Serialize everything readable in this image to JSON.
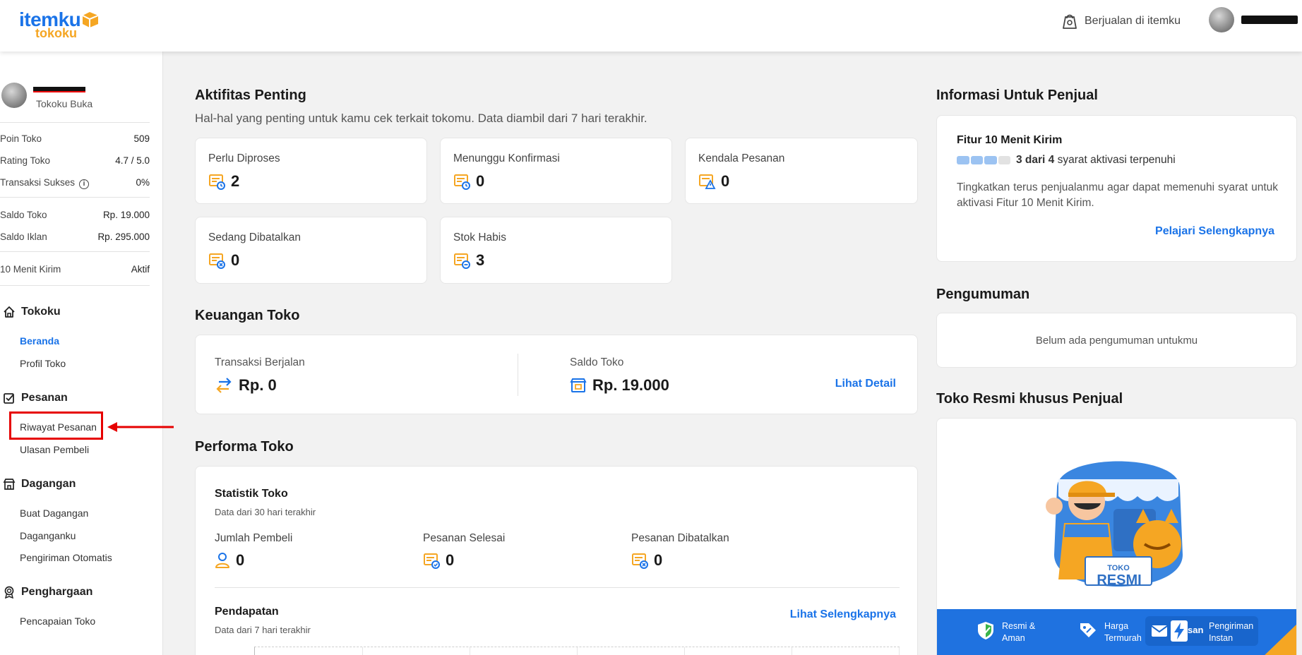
{
  "header": {
    "logo_main": "itemku",
    "logo_sub": "tokoku",
    "sell_label": "Berjualan di itemku"
  },
  "sidebar": {
    "shop_status": "Tokoku Buka",
    "stats": [
      {
        "label": "Poin Toko",
        "value": "509"
      },
      {
        "label": "Rating Toko",
        "value": "4.7 / 5.0"
      },
      {
        "label": "Transaksi Sukses",
        "value": "0%"
      },
      {
        "label": "Saldo Toko",
        "value": "Rp. 19.000"
      },
      {
        "label": "Saldo Iklan",
        "value": "Rp. 295.000"
      },
      {
        "label": "10 Menit Kirim",
        "value": "Aktif"
      }
    ],
    "sections": [
      {
        "title": "Tokoku",
        "items": [
          "Beranda",
          "Profil Toko"
        ]
      },
      {
        "title": "Pesanan",
        "items": [
          "Riwayat Pesanan",
          "Ulasan Pembeli"
        ]
      },
      {
        "title": "Dagangan",
        "items": [
          "Buat Dagangan",
          "Daganganku",
          "Pengiriman Otomatis"
        ]
      },
      {
        "title": "Penghargaan",
        "items": [
          "Pencapaian Toko"
        ]
      }
    ]
  },
  "aktifitas": {
    "title": "Aktifitas Penting",
    "subtitle": "Hal-hal yang penting untuk kamu cek terkait tokomu. Data diambil dari 7 hari terakhir.",
    "cards": [
      {
        "label": "Perlu Diproses",
        "value": "2"
      },
      {
        "label": "Menunggu Konfirmasi",
        "value": "0"
      },
      {
        "label": "Kendala Pesanan",
        "value": "0"
      },
      {
        "label": "Sedang Dibatalkan",
        "value": "0"
      },
      {
        "label": "Stok Habis",
        "value": "3"
      }
    ]
  },
  "keuangan": {
    "title": "Keuangan Toko",
    "transaksi_label": "Transaksi Berjalan",
    "transaksi_value": "Rp. 0",
    "saldo_label": "Saldo Toko",
    "saldo_value": "Rp. 19.000",
    "detail_link": "Lihat Detail"
  },
  "performa": {
    "title": "Performa Toko",
    "stat_title": "Statistik Toko",
    "stat_sub": "Data dari 30 hari terakhir",
    "metrics": [
      {
        "label": "Jumlah Pembeli",
        "value": "0"
      },
      {
        "label": "Pesanan Selesai",
        "value": "0"
      },
      {
        "label": "Pesanan Dibatalkan",
        "value": "0"
      }
    ],
    "pendapatan_title": "Pendapatan",
    "pendapatan_sub": "Data dari 7 hari terakhir",
    "more_link": "Lihat Selengkapnya"
  },
  "info_penjual": {
    "title": "Informasi Untuk Penjual",
    "card_title": "Fitur 10 Menit Kirim",
    "progress_bold": "3 dari 4",
    "progress_rest": "syarat aktivasi terpenuhi",
    "progress_filled": 3,
    "progress_total": 4,
    "description": "Tingkatkan terus penjualanmu agar dapat memenuhi syarat untuk aktivasi Fitur 10 Menit Kirim.",
    "link": "Pelajari Selengkapnya"
  },
  "pengumuman": {
    "title": "Pengumuman",
    "empty": "Belum ada pengumuman untukmu"
  },
  "toko_resmi": {
    "title": "Toko Resmi khusus Penjual",
    "sign": "TOKO",
    "sign_big": "RESMI",
    "features": [
      {
        "l1": "Resmi &",
        "l2": "Aman"
      },
      {
        "l1": "Harga",
        "l2": "Termurah"
      },
      {
        "l1": "Pengiriman",
        "l2": "Instan"
      }
    ],
    "chat_overlay": "san"
  }
}
